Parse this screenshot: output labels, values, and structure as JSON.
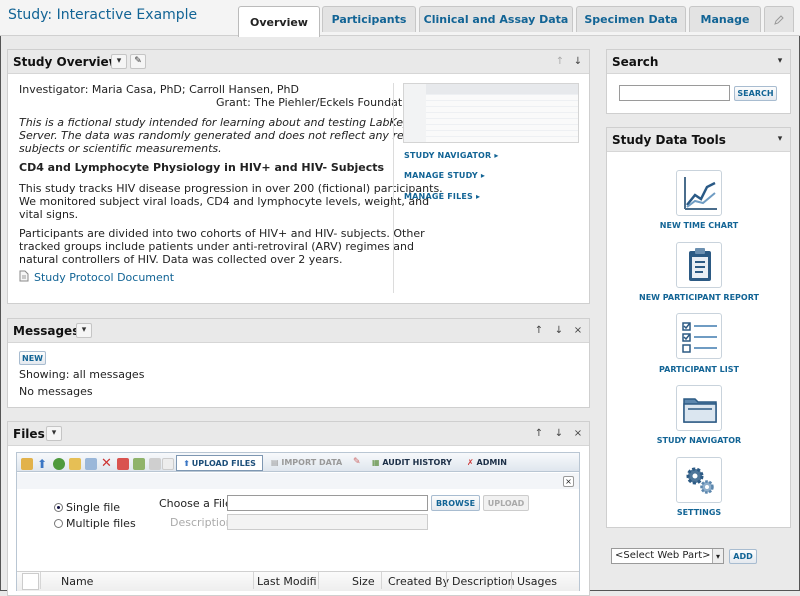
{
  "header": {
    "study_title": "Study: Interactive Example",
    "tabs": [
      {
        "label": "Overview"
      },
      {
        "label": "Participants"
      },
      {
        "label": "Clinical and Assay Data"
      },
      {
        "label": "Specimen Data"
      },
      {
        "label": "Manage"
      }
    ],
    "active_tab": "Overview",
    "edit_icon": "pencil-icon"
  },
  "study_overview": {
    "title": "Study Overview",
    "investigator": "Investigator: Maria Casa, PhD; Carroll Hansen, PhD",
    "grant": "Grant: The Piehler/Eckels Foundation",
    "intro_line1": "This is a fictional study intended for learning about and testing LabKey",
    "intro_line2": "Server. The data was randomly generated and does not reflect any real",
    "intro_line3": "subjects or scientific measurements.",
    "heading": "CD4 and Lymphocyte Physiology in HIV+ and HIV- Subjects",
    "para1_line1": "This study tracks HIV disease progression in over 200 (fictional) participants.",
    "para1_line2": "We monitored subject viral loads, CD4 and lymphocyte levels, weight, and",
    "para1_line3": "vital signs.",
    "para2_line1": "Participants are divided into two cohorts of HIV+ and HIV- subjects. Other",
    "para2_line2": "tracked groups include patients under anti-retroviral (ARV) regimes and",
    "para2_line3": "natural controllers of HIV. Data was collected over 2 years.",
    "protocol_link": "Study Protocol Document",
    "nav_links": {
      "study_navigator": "STUDY NAVIGATOR",
      "manage_study": "MANAGE STUDY",
      "manage_files": "MANAGE FILES"
    }
  },
  "messages": {
    "title": "Messages",
    "new_button": "NEW",
    "showing": "Showing:",
    "showing_value": "all messages",
    "empty": "No messages"
  },
  "files": {
    "title": "Files",
    "toolbar": {
      "upload_files": "UPLOAD FILES",
      "import_data": "IMPORT DATA",
      "audit_history": "AUDIT HISTORY",
      "admin": "ADMIN"
    },
    "single_file": "Single file",
    "multiple_files": "Multiple files",
    "choose_label": "Choose a File:",
    "description_label": "Description:",
    "browse_button": "BROWSE",
    "upload_button": "UPLOAD",
    "columns": [
      "Name",
      "Last Modified",
      "Size",
      "Created By",
      "Description",
      "Usages"
    ]
  },
  "search": {
    "title": "Search",
    "button": "SEARCH",
    "value": ""
  },
  "tools": {
    "title": "Study Data Tools",
    "items": [
      {
        "label": "NEW TIME CHART",
        "icon": "time-chart-icon"
      },
      {
        "label": "NEW PARTICIPANT REPORT",
        "icon": "participant-report-icon"
      },
      {
        "label": "PARTICIPANT LIST",
        "icon": "participant-list-icon"
      },
      {
        "label": "STUDY NAVIGATOR",
        "icon": "study-navigator-icon"
      },
      {
        "label": "SETTINGS",
        "icon": "settings-icon"
      }
    ]
  },
  "webpart": {
    "select_value": "<Select Web Part>",
    "add_button": "ADD"
  },
  "colors": {
    "link": "#126495",
    "panel_header": "#e9e9e9",
    "background": "#eaeaea"
  }
}
